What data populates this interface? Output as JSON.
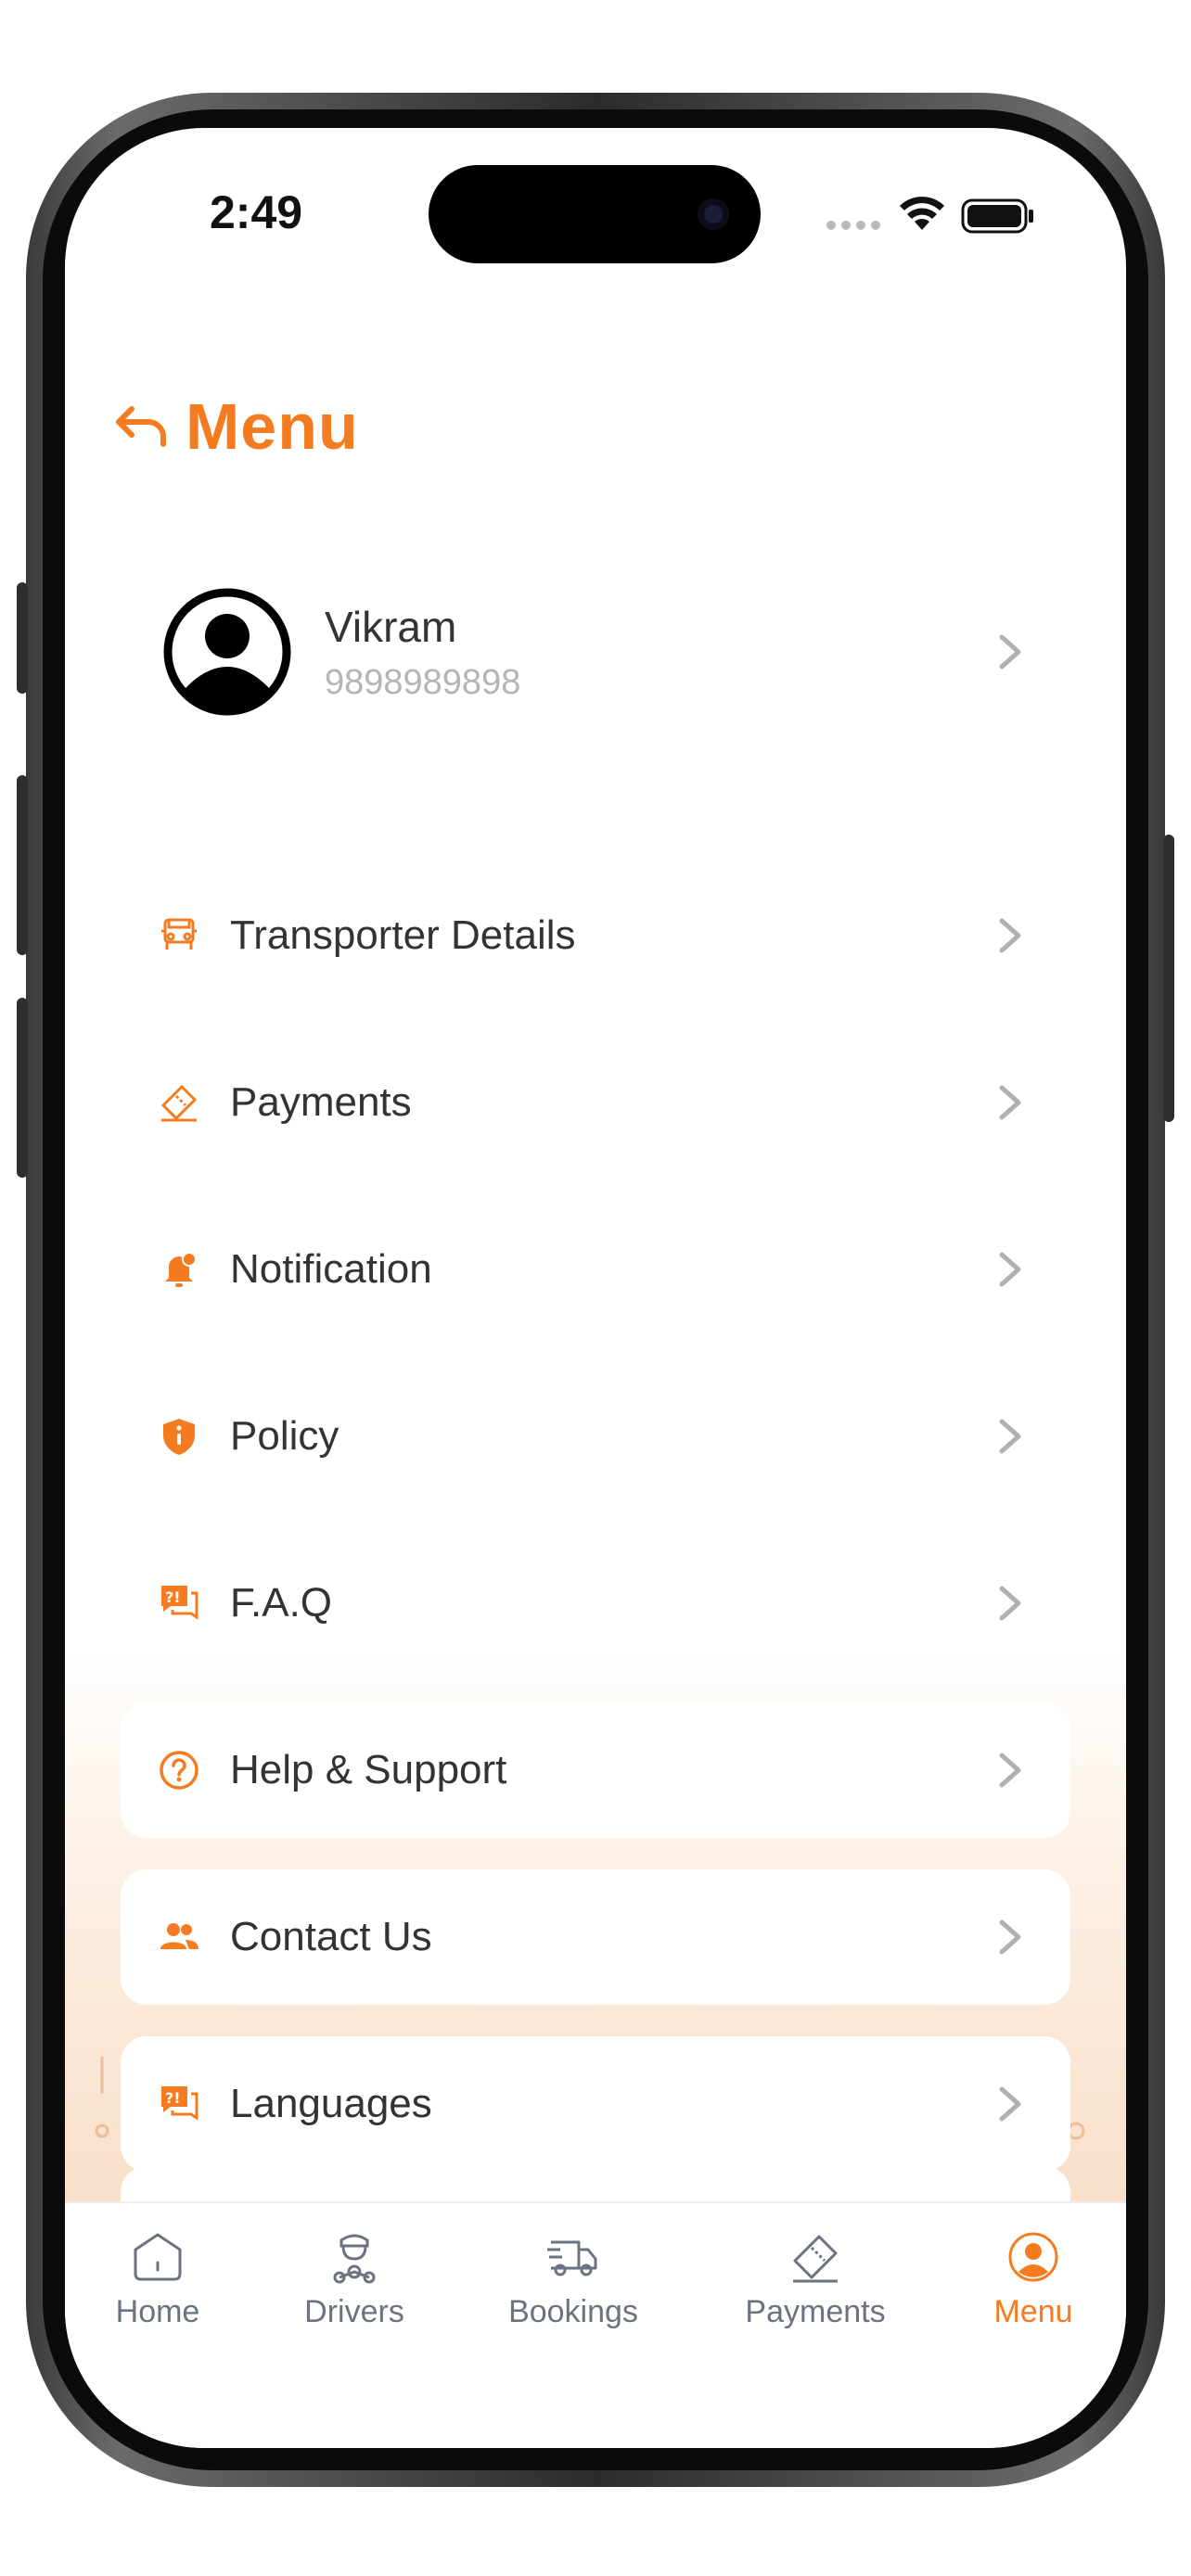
{
  "status_bar": {
    "time": "2:49"
  },
  "header": {
    "title": "Menu"
  },
  "profile": {
    "name": "Vikram",
    "phone": "9898989898"
  },
  "menu_items": [
    {
      "label": "Transporter Details",
      "icon": "truck-icon"
    },
    {
      "label": "Payments",
      "icon": "ticket-icon"
    },
    {
      "label": "Notification",
      "icon": "bell-icon"
    },
    {
      "label": "Policy",
      "icon": "shield-info-icon"
    },
    {
      "label": "F.A.Q",
      "icon": "faq-icon"
    },
    {
      "label": "Help & Support",
      "icon": "help-icon"
    },
    {
      "label": "Contact Us",
      "icon": "people-icon"
    },
    {
      "label": "Languages",
      "icon": "language-icon"
    }
  ],
  "tabbar": {
    "tabs": [
      {
        "label": "Home",
        "icon": "home-icon",
        "active": false
      },
      {
        "label": "Drivers",
        "icon": "driver-icon",
        "active": false
      },
      {
        "label": "Bookings",
        "icon": "truck-icon",
        "active": false
      },
      {
        "label": "Payments",
        "icon": "ticket-icon",
        "active": false
      },
      {
        "label": "Menu",
        "icon": "profile-icon",
        "active": true
      }
    ]
  },
  "colors": {
    "accent": "#F47B20",
    "text": "#333333",
    "muted": "#B5B5B5",
    "tab_inactive": "#6B7280"
  }
}
